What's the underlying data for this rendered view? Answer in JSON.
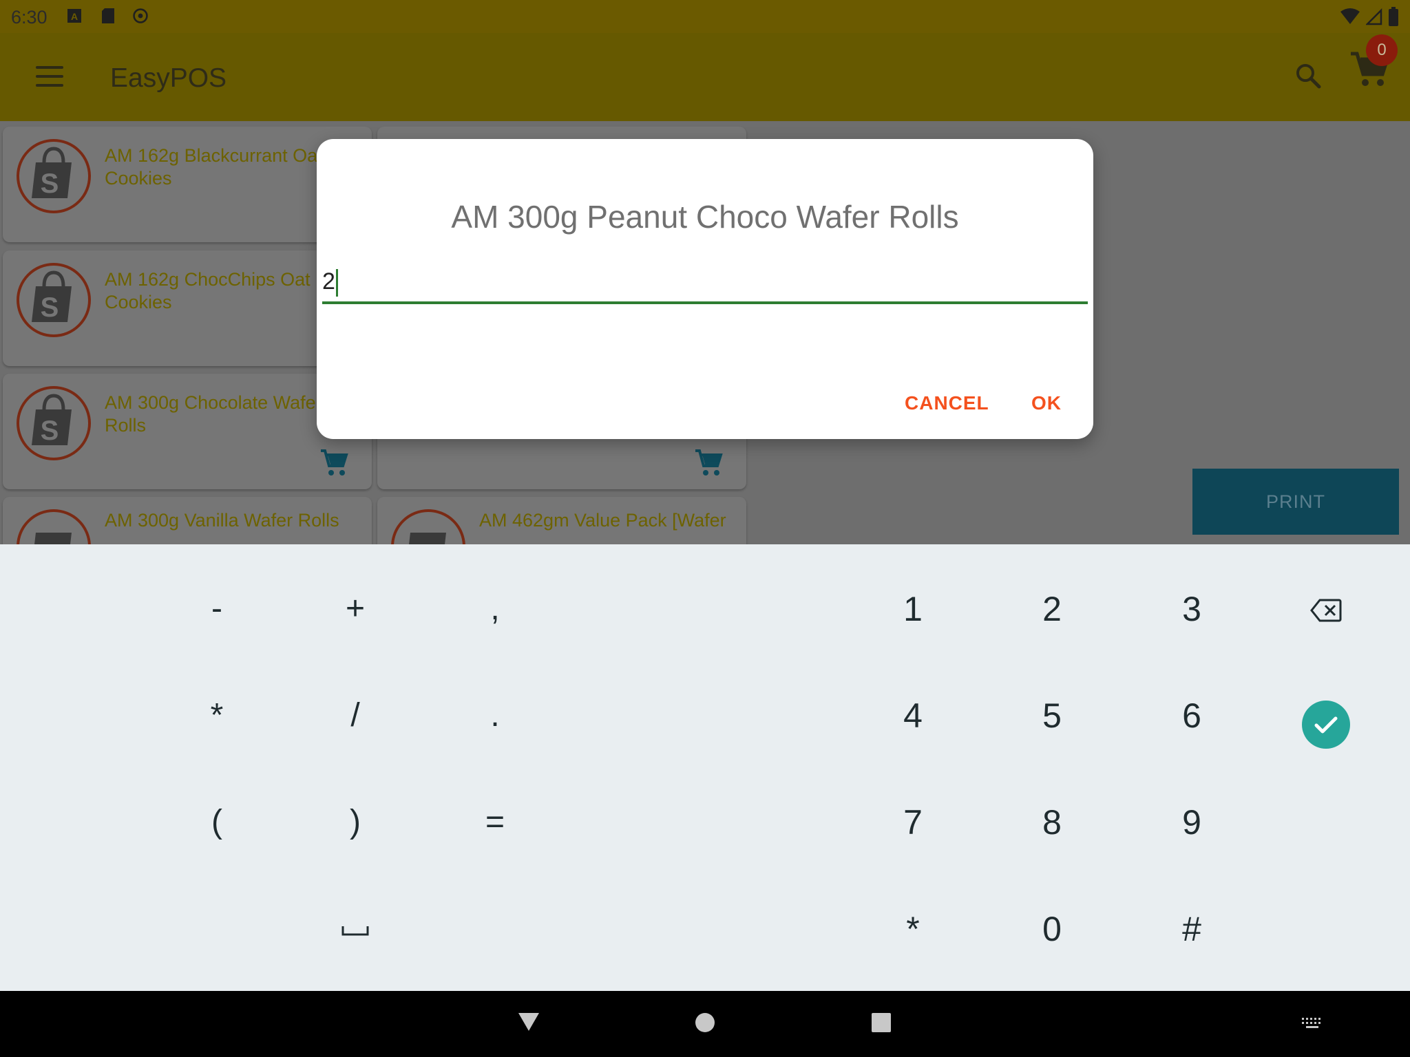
{
  "status_bar": {
    "time": "6:30"
  },
  "app_bar": {
    "title": "EasyPOS",
    "cart_count": "0"
  },
  "products": [
    {
      "name": "AM 162g Blackcurrant Oat Cookies"
    },
    {
      "name": "AM 162g ChocChips Oat Cookies"
    },
    {
      "name": "AM 300g Chocolate Wafer Rolls"
    },
    {
      "name": "AM 300g Vanilla Wafer Rolls"
    },
    {
      "name": "AM 462gm Value Pack [Wafer"
    }
  ],
  "print_button": {
    "label": "PRINT"
  },
  "dialog": {
    "title": "AM 300g Peanut Choco Wafer Rolls",
    "input_value": "2",
    "cancel_label": "CANCEL",
    "ok_label": "OK"
  },
  "keyboard": {
    "symbols_row1": [
      "-",
      "+",
      ","
    ],
    "symbols_row2": [
      "*",
      "/",
      "."
    ],
    "symbols_row3": [
      "(",
      ")",
      "="
    ],
    "space_symbol": "␣",
    "digits_row1": [
      "1",
      "2",
      "3"
    ],
    "digits_row2": [
      "4",
      "5",
      "6"
    ],
    "digits_row3": [
      "7",
      "8",
      "9"
    ],
    "digits_row4": [
      "*",
      "0",
      "#"
    ],
    "accent_color": "#26a69a"
  },
  "colors": {
    "app_bar": "#665900",
    "status_bar": "#6b5a00",
    "accent_orange": "#f4511e",
    "input_underline": "#2e7d32"
  }
}
